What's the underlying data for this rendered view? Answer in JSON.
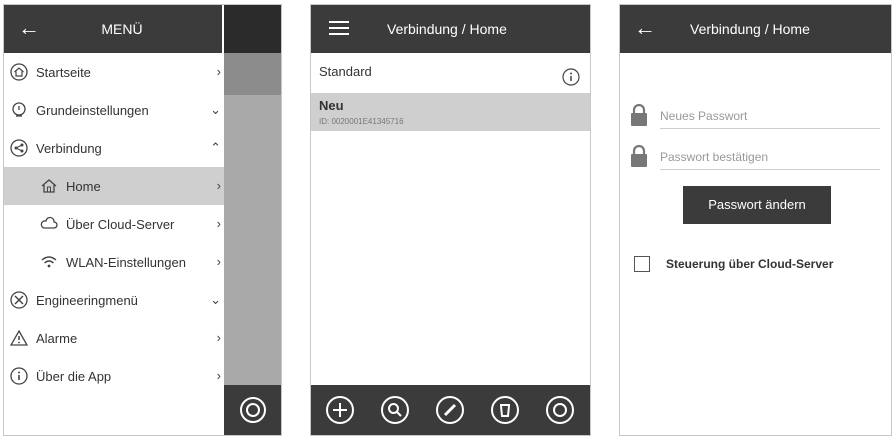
{
  "screen_menu": {
    "title": "MENÜ",
    "items": [
      {
        "label": "Startseite",
        "arrow": "›"
      },
      {
        "label": "Grundeinstellungen",
        "arrow": "⌄"
      },
      {
        "label": "Verbindung",
        "arrow": "⌃"
      },
      {
        "label": "Home",
        "arrow": "›"
      },
      {
        "label": "Über Cloud-Server",
        "arrow": "›"
      },
      {
        "label": "WLAN-Einstellungen",
        "arrow": "›"
      },
      {
        "label": "Engineeringmenü",
        "arrow": "⌄"
      },
      {
        "label": "Alarme",
        "arrow": "›"
      },
      {
        "label": "Über die App",
        "arrow": "›"
      }
    ]
  },
  "screen_list": {
    "title": "Verbindung / Home",
    "standard_label": "Standard",
    "selected": {
      "name": "Neu",
      "id": "ID: 0020001E41345716"
    }
  },
  "screen_password": {
    "title": "Verbindung / Home",
    "new_password_placeholder": "Neues Passwort",
    "confirm_password_placeholder": "Passwort bestätigen",
    "change_button": "Passwort ändern",
    "cloud_control_label": "Steuerung über Cloud-Server"
  },
  "colors": {
    "topbar": "#3b3b3b",
    "selected_row": "#cfcfcf",
    "overlay": "#a9a9a9"
  }
}
